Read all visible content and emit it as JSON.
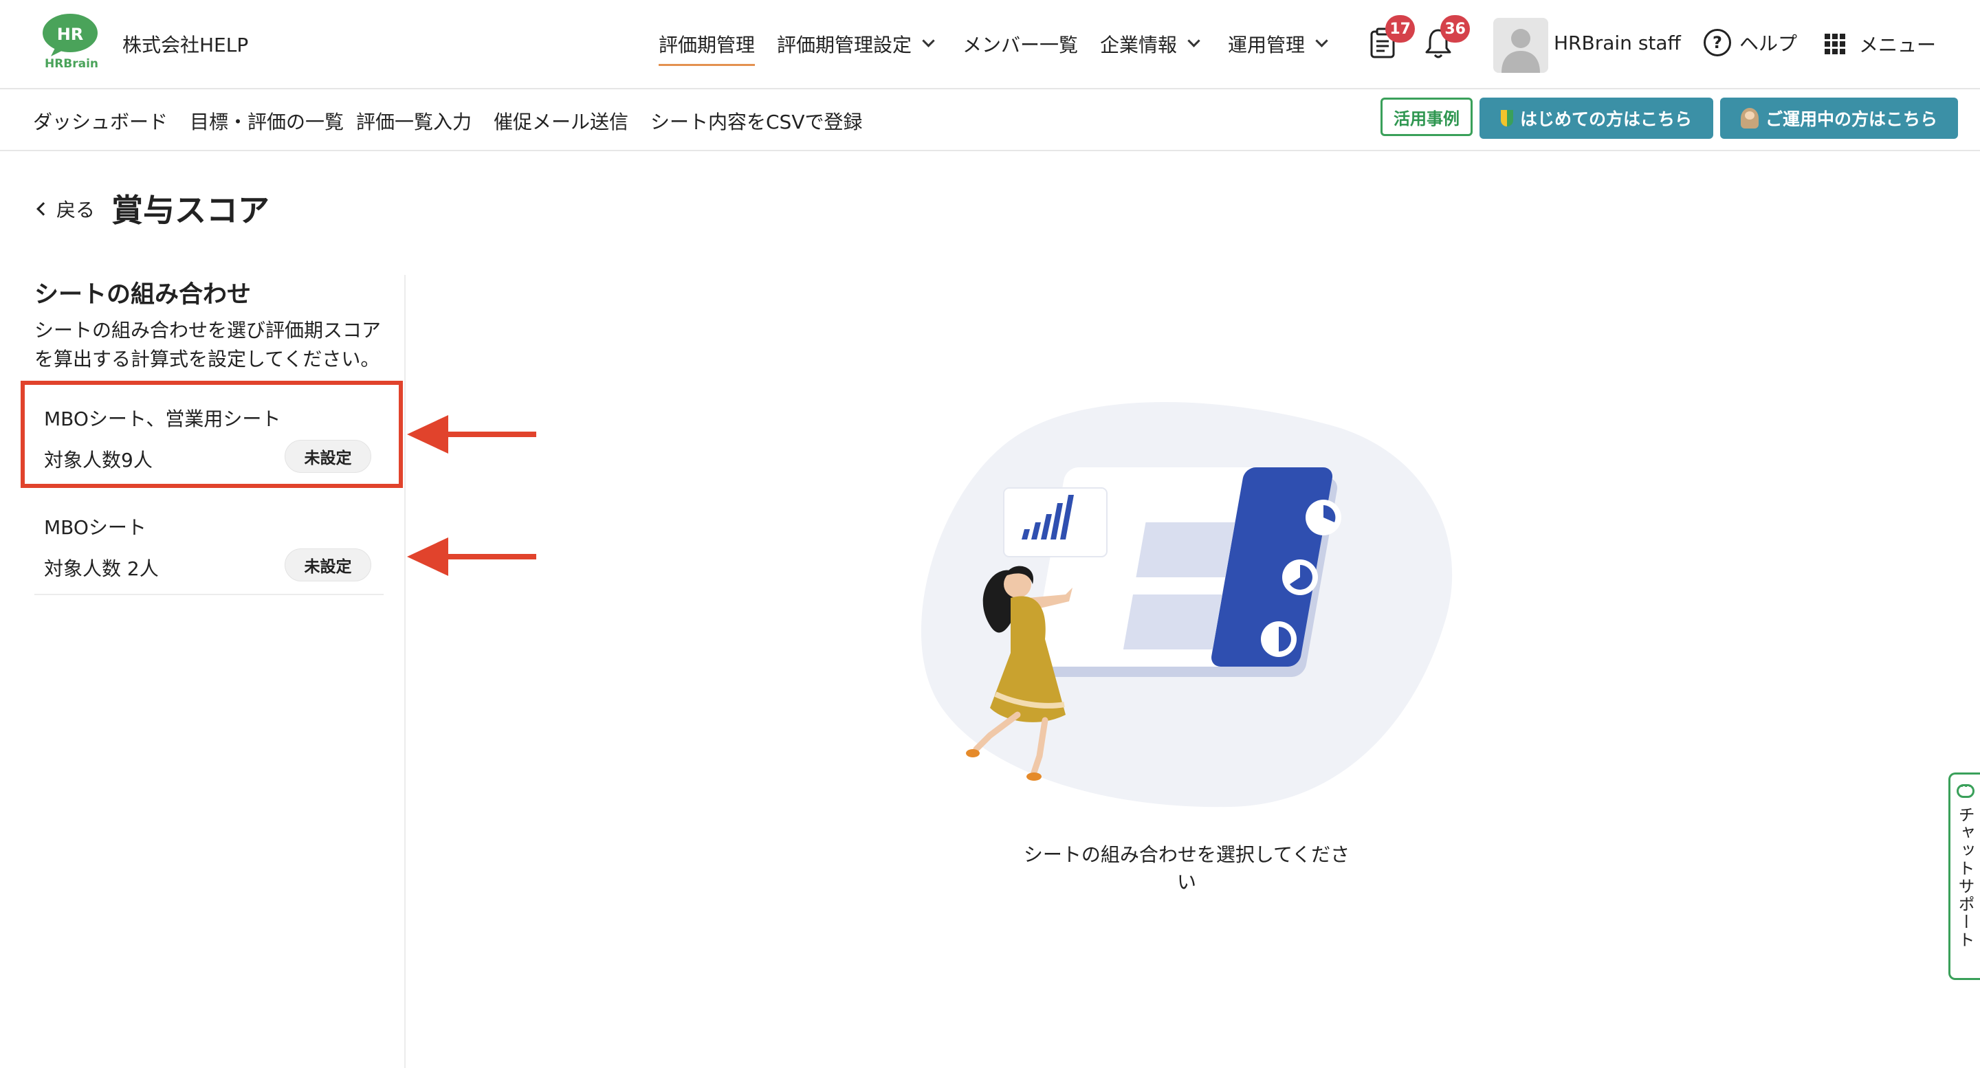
{
  "header": {
    "logo_text_top": "HR",
    "logo_text_bottom": "HRBrain",
    "company": "株式会社HELP",
    "nav": [
      {
        "label": "評価期管理",
        "active": true,
        "dropdown": false
      },
      {
        "label": "評価期管理設定",
        "active": false,
        "dropdown": true
      },
      {
        "label": "メンバー一覧",
        "active": false,
        "dropdown": false
      },
      {
        "label": "企業情報",
        "active": false,
        "dropdown": true
      },
      {
        "label": "運用管理",
        "active": false,
        "dropdown": true
      }
    ],
    "tasks_badge": "17",
    "notifications_badge": "36",
    "user_name": "HRBrain staff",
    "help_label": "ヘルプ",
    "menu_label": "メニュー"
  },
  "subnav": {
    "items": [
      "ダッシュボード",
      "目標・評価の一覧",
      "評価一覧入力",
      "催促メール送信",
      "シート内容をCSVで登録"
    ],
    "case_button": "活用事例",
    "first_button": "はじめての方はこちら",
    "using_button": "ご運用中の方はこちら"
  },
  "page": {
    "back_label": "戻る",
    "title": "賞与スコア"
  },
  "panel": {
    "title": "シートの組み合わせ",
    "description": "シートの組み合わせを選び評価期スコアを算出する計算式を設定してください。",
    "combinations": [
      {
        "name": "MBOシート、営業用シート",
        "count": "対象人数9人",
        "status": "未設定"
      },
      {
        "name": "MBOシート",
        "count": "対象人数 2人",
        "status": "未設定"
      }
    ]
  },
  "main": {
    "empty_message": "シートの組み合わせを選択してください"
  },
  "chat": {
    "label": "チャットサポート"
  },
  "colors": {
    "accent_orange": "#e39150",
    "badge_red": "#d5414a",
    "brand_green": "#3aa05a",
    "button_teal": "#3b90a6",
    "annotation_red": "#e1432c",
    "illustration_blue": "#2f4fb0"
  }
}
